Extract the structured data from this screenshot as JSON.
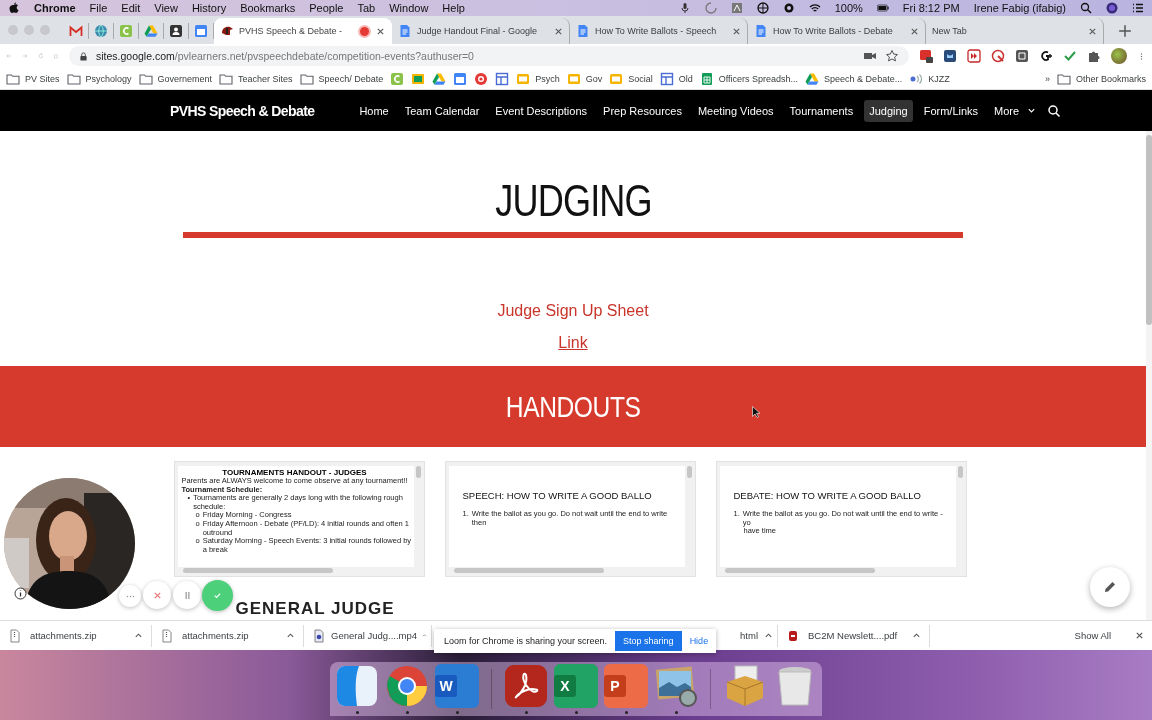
{
  "menubar": {
    "app": "Chrome",
    "menus": [
      "File",
      "Edit",
      "View",
      "History",
      "Bookmarks",
      "People",
      "Tab",
      "Window",
      "Help"
    ],
    "battery": "100%",
    "clock": "Fri 8:12 PM",
    "user": "Irene Fabig (ifabig)"
  },
  "tabs": [
    {
      "title": "PVHS Speech & Debate -",
      "kind": "site",
      "selected": true,
      "recording": true
    },
    {
      "title": "Judge Handout Final - Google",
      "kind": "doc",
      "selected": false,
      "recording": false
    },
    {
      "title": "How To Write Ballots - Speech",
      "kind": "doc",
      "selected": false,
      "recording": false
    },
    {
      "title": "How To Write Ballots - Debate",
      "kind": "doc",
      "selected": false,
      "recording": false
    },
    {
      "title": "New Tab",
      "kind": "none",
      "selected": false,
      "recording": false
    }
  ],
  "address": {
    "host": "sites.google.com",
    "path": "/pvlearners.net/pvspeechdebate/competition-events?authuser=0"
  },
  "bookmarks": [
    {
      "label": "PV Sites",
      "kind": "folder"
    },
    {
      "label": "Psychology",
      "kind": "folder"
    },
    {
      "label": "Governement",
      "kind": "folder"
    },
    {
      "label": "Teacher Sites",
      "kind": "folder"
    },
    {
      "label": "Speech/ Debate",
      "kind": "folder"
    },
    {
      "kind": "classroom"
    },
    {
      "kind": "board"
    },
    {
      "kind": "drive"
    },
    {
      "kind": "calendar"
    },
    {
      "kind": "record"
    },
    {
      "kind": "layout"
    },
    {
      "label": "Psych",
      "kind": "slides"
    },
    {
      "label": "Gov",
      "kind": "slides"
    },
    {
      "label": "Social",
      "kind": "slides"
    },
    {
      "label": "Old",
      "kind": "layout"
    },
    {
      "label": "Officers Spreadsh...",
      "kind": "sheets"
    },
    {
      "label": "Speech & Debate...",
      "kind": "drive"
    },
    {
      "label": "KJZZ",
      "kind": "radio"
    }
  ],
  "bookmarks_more": "»",
  "other_bookmarks": "Other Bookmarks",
  "site": {
    "title": "PVHS Speech & Debate",
    "nav": [
      {
        "label": "Home",
        "selected": false
      },
      {
        "label": "Team Calendar",
        "selected": false
      },
      {
        "label": "Event Descriptions",
        "selected": false
      },
      {
        "label": "Prep Resources",
        "selected": false
      },
      {
        "label": "Meeting Videos",
        "selected": false
      },
      {
        "label": "Tournaments",
        "selected": false
      },
      {
        "label": "Judging",
        "selected": true
      },
      {
        "label": "Form/Links",
        "selected": false
      },
      {
        "label": "More",
        "selected": false
      }
    ]
  },
  "hero": {
    "heading": "JUDGING",
    "signup": "Judge Sign Up Sheet",
    "link": "Link"
  },
  "handouts": {
    "heading": "HANDOUTS",
    "cards": [
      {
        "kind": "schedule",
        "title": "TOURNAMENTS HANDOUT - JUDGES",
        "lines": [
          {
            "kind": "subtitle",
            "text": "Parents are ALWAYS welcome to come observe at any tournament!!"
          },
          {
            "kind": "heading",
            "text": "Tournament Schedule:"
          },
          {
            "kind": "bullet",
            "marker": "•",
            "text": "Tournaments are generally 2 days long with the following rough schedule:"
          },
          {
            "kind": "subbullet",
            "marker": "o",
            "text": "Friday Morning - Congress"
          },
          {
            "kind": "subbullet",
            "marker": "o",
            "text": "Friday Afternoon - Debate (PF/LD): 4 initial rounds and often 1 outround"
          },
          {
            "kind": "subbullet",
            "marker": "o",
            "text": "Saturday Morning - Speech Events: 3 initial rounds followed by a break"
          }
        ]
      },
      {
        "kind": "ballot",
        "title": "SPEECH: HOW TO WRITE A GOOD BALLO",
        "lines": [
          {
            "kind": "numbered",
            "marker": "1.",
            "text": "Write the ballot as you go. Do not wait until the end to write then"
          }
        ]
      },
      {
        "kind": "ballot",
        "title": "DEBATE: HOW TO WRITE A GOOD BALLO",
        "lines": [
          {
            "kind": "numbered",
            "marker": "1.",
            "text": "Write the ballot as you go. Do not wait until the end to write - yo"
          },
          {
            "kind": "continued",
            "text": "have time"
          }
        ]
      }
    ]
  },
  "next_section": "GENERAL JUDGE",
  "downloads": {
    "items": [
      {
        "name": "attachments.zip",
        "kind": "zip"
      },
      {
        "name": "attachments.zip",
        "kind": "zip"
      },
      {
        "name": "General Judg....mp4",
        "kind": "video"
      },
      {
        "name": "html",
        "kind": "none"
      },
      {
        "name": "BC2M Newslett....pdf",
        "kind": "pdf"
      }
    ],
    "show_all": "Show All"
  },
  "loom": {
    "message": "Loom for Chrome is sharing your screen.",
    "stop": "Stop sharing",
    "hide": "Hide"
  },
  "dock": [
    {
      "kind": "finder",
      "running": true
    },
    {
      "kind": "chrome",
      "running": true
    },
    {
      "kind": "word",
      "letter": "W",
      "running": true
    },
    {
      "kind": "acrobat",
      "running": true
    },
    {
      "kind": "excel",
      "letter": "X",
      "running": true
    },
    {
      "kind": "powerpoint",
      "letter": "P",
      "running": true
    },
    {
      "kind": "preview",
      "running": true
    },
    {
      "kind": "installer",
      "running": false
    },
    {
      "kind": "trash",
      "running": false
    }
  ]
}
